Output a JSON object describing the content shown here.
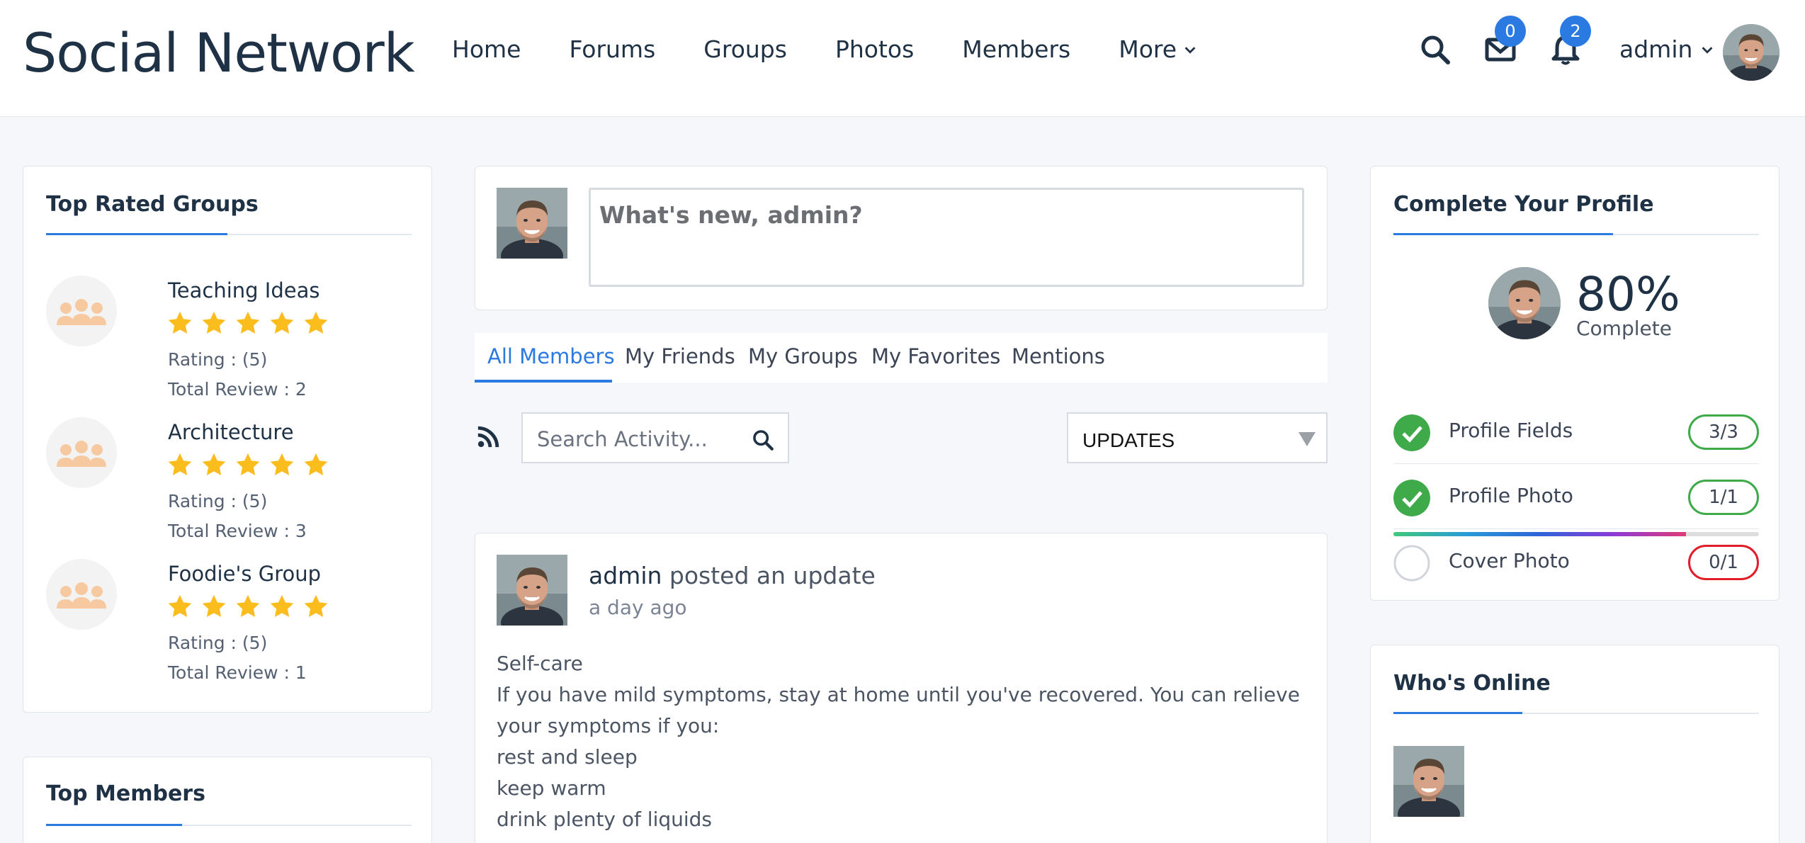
{
  "brand": {
    "logo": "Social Network",
    "accent": "#2a7ae2"
  },
  "nav": {
    "items": [
      "Home",
      "Forums",
      "Groups",
      "Photos",
      "Members",
      "More"
    ],
    "messages_count": "0",
    "notifications_count": "2",
    "username": "admin"
  },
  "top_rated_groups": {
    "title": "Top Rated Groups",
    "groups": [
      {
        "name": "Teaching Ideas",
        "rating": "Rating : (5)",
        "reviews": "Total Review : 2",
        "stars": 5
      },
      {
        "name": "Architecture",
        "rating": "Rating : (5)",
        "reviews": "Total Review : 3",
        "stars": 5
      },
      {
        "name": "Foodie's Group",
        "rating": "Rating : (5)",
        "reviews": "Total Review : 1",
        "stars": 5
      }
    ]
  },
  "top_members": {
    "title": "Top Members"
  },
  "composer": {
    "placeholder": "What's new, admin?"
  },
  "activity_tabs": [
    "All Members",
    "My Friends",
    "My Groups",
    "My Favorites",
    "Mentions"
  ],
  "filters": {
    "search_placeholder": "Search Activity...",
    "select_value": "UPDATES"
  },
  "post": {
    "author": "admin",
    "action": " posted an update",
    "time": "a day ago",
    "lines": [
      "Self-care",
      "If you have mild symptoms, stay at home until you've recovered. You can relieve your symptoms if you:",
      "rest and sleep",
      "keep warm",
      "drink plenty of liquids"
    ]
  },
  "profile": {
    "title": "Complete Your Profile",
    "percent": "80%",
    "percent_label": "Complete",
    "progress": 0.8,
    "rows": [
      {
        "label": "Profile Fields",
        "value": "3/3",
        "done": true
      },
      {
        "label": "Profile Photo",
        "value": "1/1",
        "done": true
      },
      {
        "label": "Cover Photo",
        "value": "0/1",
        "done": false
      }
    ]
  },
  "whos_online": {
    "title": "Who's Online"
  }
}
